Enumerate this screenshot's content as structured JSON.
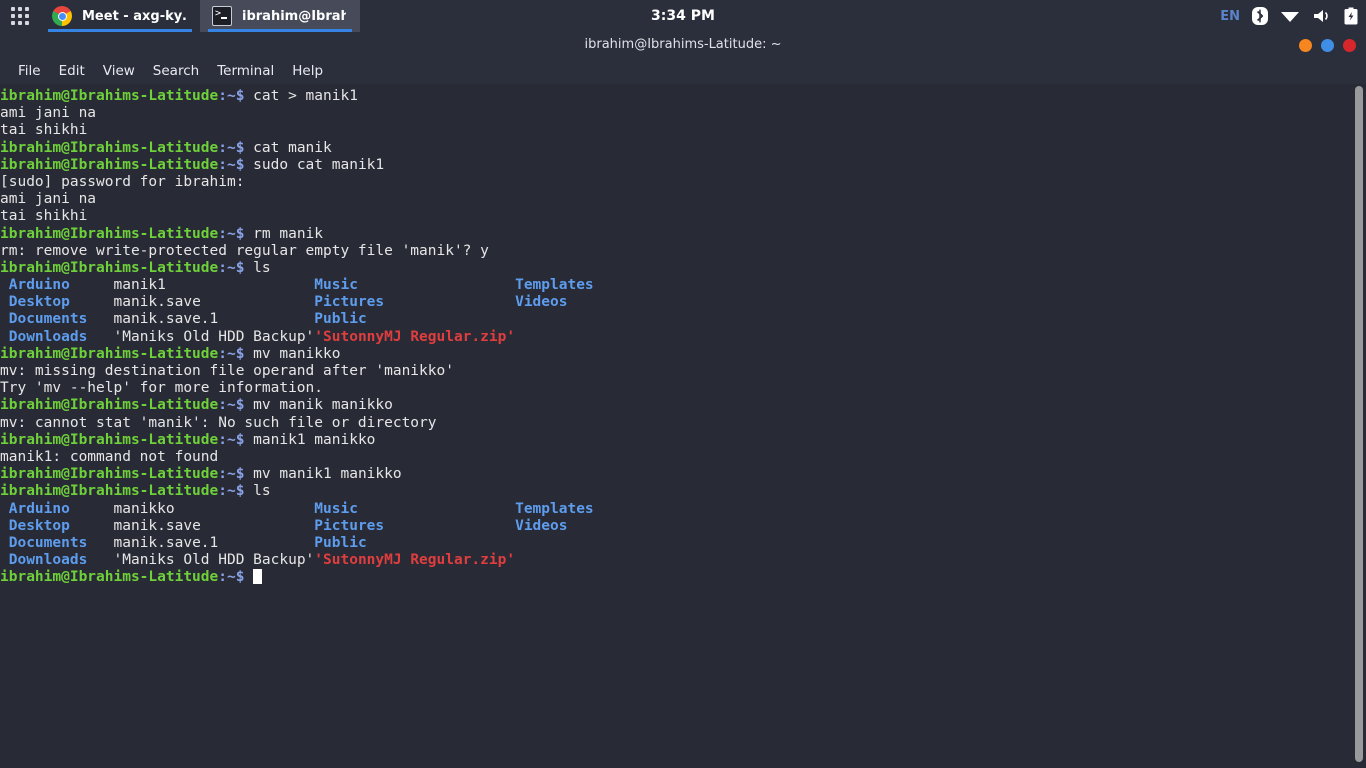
{
  "top_panel": {
    "apps_button": "apps-grid",
    "tasks": [
      {
        "icon": "chrome-icon",
        "label": "Meet - axg-ky…",
        "active": false
      },
      {
        "icon": "terminal-icon",
        "label": "ibrahim@Ibrah…",
        "active": true
      }
    ],
    "clock": "3:34 PM",
    "tray": {
      "keyboard_layout": "EN",
      "icons": [
        "bluetooth-icon",
        "wifi-icon",
        "volume-icon",
        "battery-icon"
      ]
    }
  },
  "window": {
    "title": "ibrahim@Ibrahims-Latitude: ~",
    "buttons": [
      "minimize-button",
      "maximize-button",
      "close-button"
    ],
    "menu": [
      "File",
      "Edit",
      "View",
      "Search",
      "Terminal",
      "Help"
    ]
  },
  "terminal": {
    "prompt_user": "ibrahim@Ibrahims-Latitude",
    "prompt_path": ":~$",
    "cursor": "block-cursor",
    "lines": [
      {
        "type": "prompt",
        "command": "cat > manik1"
      },
      {
        "type": "output",
        "text": "ami jani na"
      },
      {
        "type": "output",
        "text": "tai shikhi"
      },
      {
        "type": "prompt",
        "command": "cat manik"
      },
      {
        "type": "prompt",
        "command": "sudo cat manik1"
      },
      {
        "type": "output",
        "text": "[sudo] password for ibrahim:"
      },
      {
        "type": "output",
        "text": "ami jani na"
      },
      {
        "type": "output",
        "text": "tai shikhi"
      },
      {
        "type": "prompt",
        "command": "rm manik"
      },
      {
        "type": "output",
        "text": "rm: remove write-protected regular empty file 'manik'? y"
      },
      {
        "type": "prompt",
        "command": "ls"
      },
      {
        "type": "ls",
        "cells": [
          {
            "text": " Arduino",
            "kind": "dir",
            "pad": 13
          },
          {
            "text": "manik1",
            "kind": "plain",
            "pad": 23
          },
          {
            "text": "Music",
            "kind": "dir",
            "pad": 23
          },
          {
            "text": "Templates",
            "kind": "dir",
            "pad": 0
          }
        ]
      },
      {
        "type": "ls",
        "cells": [
          {
            "text": " Desktop",
            "kind": "dir",
            "pad": 13
          },
          {
            "text": "manik.save",
            "kind": "plain",
            "pad": 23
          },
          {
            "text": "Pictures",
            "kind": "dir",
            "pad": 23
          },
          {
            "text": "Videos",
            "kind": "dir",
            "pad": 0
          }
        ]
      },
      {
        "type": "ls",
        "cells": [
          {
            "text": " Documents",
            "kind": "dir",
            "pad": 13
          },
          {
            "text": "manik.save.1",
            "kind": "plain",
            "pad": 23
          },
          {
            "text": "Public",
            "kind": "dir",
            "pad": 23
          }
        ]
      },
      {
        "type": "ls",
        "cells": [
          {
            "text": " Downloads",
            "kind": "dir",
            "pad": 13
          },
          {
            "text": "'Maniks Old HDD Backup'",
            "kind": "plain",
            "pad": 23
          },
          {
            "text": "'SutonnyMJ Regular.zip'",
            "kind": "archive",
            "pad": 0
          }
        ]
      },
      {
        "type": "prompt",
        "command": "mv manikko"
      },
      {
        "type": "output",
        "text": "mv: missing destination file operand after 'manikko'"
      },
      {
        "type": "output",
        "text": "Try 'mv --help' for more information."
      },
      {
        "type": "prompt",
        "command": "mv manik manikko"
      },
      {
        "type": "output",
        "text": "mv: cannot stat 'manik': No such file or directory"
      },
      {
        "type": "prompt",
        "command": "manik1 manikko"
      },
      {
        "type": "output",
        "text": "manik1: command not found"
      },
      {
        "type": "prompt",
        "command": "mv manik1 manikko"
      },
      {
        "type": "prompt",
        "command": "ls"
      },
      {
        "type": "ls",
        "cells": [
          {
            "text": " Arduino",
            "kind": "dir",
            "pad": 13
          },
          {
            "text": "manikko",
            "kind": "plain",
            "pad": 23
          },
          {
            "text": "Music",
            "kind": "dir",
            "pad": 23
          },
          {
            "text": "Templates",
            "kind": "dir",
            "pad": 0
          }
        ]
      },
      {
        "type": "ls",
        "cells": [
          {
            "text": " Desktop",
            "kind": "dir",
            "pad": 13
          },
          {
            "text": "manik.save",
            "kind": "plain",
            "pad": 23
          },
          {
            "text": "Pictures",
            "kind": "dir",
            "pad": 23
          },
          {
            "text": "Videos",
            "kind": "dir",
            "pad": 0
          }
        ]
      },
      {
        "type": "ls",
        "cells": [
          {
            "text": " Documents",
            "kind": "dir",
            "pad": 13
          },
          {
            "text": "manik.save.1",
            "kind": "plain",
            "pad": 23
          },
          {
            "text": "Public",
            "kind": "dir",
            "pad": 23
          }
        ]
      },
      {
        "type": "ls",
        "cells": [
          {
            "text": " Downloads",
            "kind": "dir",
            "pad": 13
          },
          {
            "text": "'Maniks Old HDD Backup'",
            "kind": "plain",
            "pad": 23
          },
          {
            "text": "'SutonnyMJ Regular.zip'",
            "kind": "archive",
            "pad": 0
          }
        ]
      },
      {
        "type": "prompt",
        "command": "",
        "cursor": true
      }
    ]
  },
  "colors": {
    "panel_bg": "#2b2e3b",
    "terminal_bg": "#282a36",
    "prompt_green": "#6fd13a",
    "prompt_path": "#8aa3e8",
    "dir_blue": "#5e9ded",
    "archive_red": "#e03e3e",
    "text": "#e6e6e6",
    "accent_blue": "#3584e4"
  }
}
